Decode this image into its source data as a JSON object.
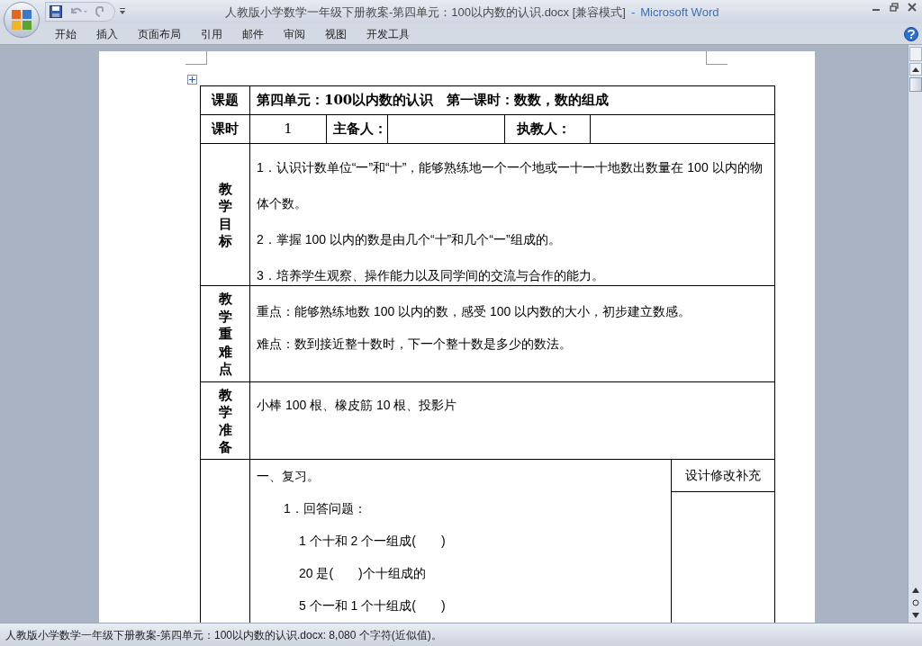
{
  "window": {
    "title": "人教版小学数学一年级下册教案-第四单元：100以内数的认识.docx [兼容模式]",
    "separator": "-",
    "app_name": "Microsoft Word"
  },
  "ribbon_tabs": [
    {
      "label": "开始",
      "selected": false
    },
    {
      "label": "插入",
      "selected": false
    },
    {
      "label": "页面布局",
      "selected": false
    },
    {
      "label": "引用",
      "selected": false
    },
    {
      "label": "邮件",
      "selected": false
    },
    {
      "label": "审阅",
      "selected": false
    },
    {
      "label": "视图",
      "selected": false
    },
    {
      "label": "开发工具",
      "selected": false
    }
  ],
  "document": {
    "lesson_table": {
      "topic_label": "课题",
      "topic": "第四单元：100以内数的认识　第一课时：数数，数的组成",
      "period_label": "课时",
      "period": "1",
      "lead_label": "主备人：",
      "teacher_label": "执教人：",
      "sections": [
        {
          "label": "教学目标",
          "paragraphs": [
            "1．认识计数单位“一”和“十”，能够熟练地一个一个地或一十一十地数出数量在 100 以内的物体个数。",
            "2．掌握 100 以内的数是由几个“十”和几个“一”组成的。",
            "3．培养学生观察、操作能力以及同学间的交流与合作的能力。"
          ]
        },
        {
          "label": "教学重难点",
          "paragraphs": [
            "重点：能够熟练地数 100 以内的数，感受 100 以内数的大小，初步建立数感。",
            "难点：数到接近整十数时，下一个整十数是多少的数法。"
          ]
        },
        {
          "label": "教学准备",
          "paragraphs": [
            "小棒 100 根、橡皮筋 10 根、投影片"
          ]
        }
      ],
      "process": {
        "lines": [
          {
            "text": "一、复习。",
            "kind": "heading"
          },
          {
            "text": "1．回答问题：",
            "kind": "item"
          },
          {
            "text": "1 个十和 2 个一组成(　　)",
            "kind": "question"
          },
          {
            "text": "20 是(　　)个十组成的",
            "kind": "question"
          },
          {
            "text": "5 个一和 1 个十组成(　　)",
            "kind": "question"
          }
        ],
        "notes_header": "设计修改补充"
      }
    }
  },
  "status_bar": {
    "text": "人教版小学数学一年级下册教案-第四单元：100以内数的认识.docx: 8,080 个字符(近似值)。"
  }
}
